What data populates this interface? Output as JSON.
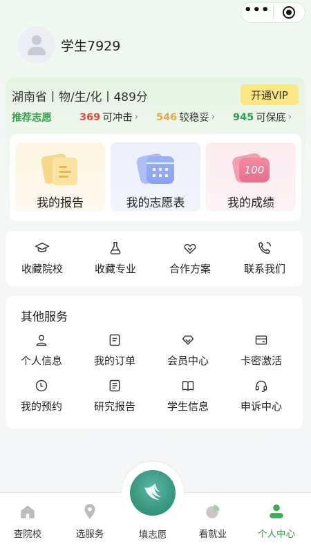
{
  "capsule": {
    "more_icon": "more-dots-icon",
    "close_icon": "target-icon"
  },
  "profile": {
    "username": "学生7929"
  },
  "score": {
    "summary": "湖南省丨物/生/化丨489分",
    "vip_label": "开通VIP",
    "recommend_label": "推荐志愿",
    "tiers": [
      {
        "count": "369",
        "label": "可冲击",
        "color": "#e24b3b"
      },
      {
        "count": "546",
        "label": "较稳妥",
        "color": "#e8a94b"
      },
      {
        "count": "945",
        "label": "可保底",
        "color": "#2f9e55"
      }
    ]
  },
  "tiles": [
    {
      "label": "我的报告",
      "icon": "report-doc-icon"
    },
    {
      "label": "我的志愿表",
      "icon": "calendar-icon"
    },
    {
      "label": "我的成绩",
      "icon": "score-100-icon",
      "badge": "100"
    }
  ],
  "quick": [
    {
      "label": "收藏院校",
      "icon": "graduation-cap-icon"
    },
    {
      "label": "收藏专业",
      "icon": "flask-icon"
    },
    {
      "label": "合作方案",
      "icon": "handshake-icon"
    },
    {
      "label": "联系我们",
      "icon": "phone-icon"
    }
  ],
  "services": {
    "title": "其他服务",
    "items": [
      {
        "label": "个人信息",
        "icon": "user-icon"
      },
      {
        "label": "我的订单",
        "icon": "order-icon"
      },
      {
        "label": "会员中心",
        "icon": "diamond-icon"
      },
      {
        "label": "卡密激活",
        "icon": "card-icon"
      },
      {
        "label": "我的预约",
        "icon": "clock-icon"
      },
      {
        "label": "研究报告",
        "icon": "document-icon"
      },
      {
        "label": "学生信息",
        "icon": "book-icon"
      },
      {
        "label": "申诉中心",
        "icon": "headset-icon"
      }
    ]
  },
  "tabbar": {
    "items": [
      {
        "label": "查院校",
        "icon": "home-icon"
      },
      {
        "label": "选服务",
        "icon": "location-pin-icon"
      },
      {
        "label": "填志愿",
        "icon": "wing-icon"
      },
      {
        "label": "看就业",
        "icon": "pie-chart-icon"
      },
      {
        "label": "个人中心",
        "icon": "person-icon"
      }
    ],
    "active_color": "#2e9e47"
  }
}
